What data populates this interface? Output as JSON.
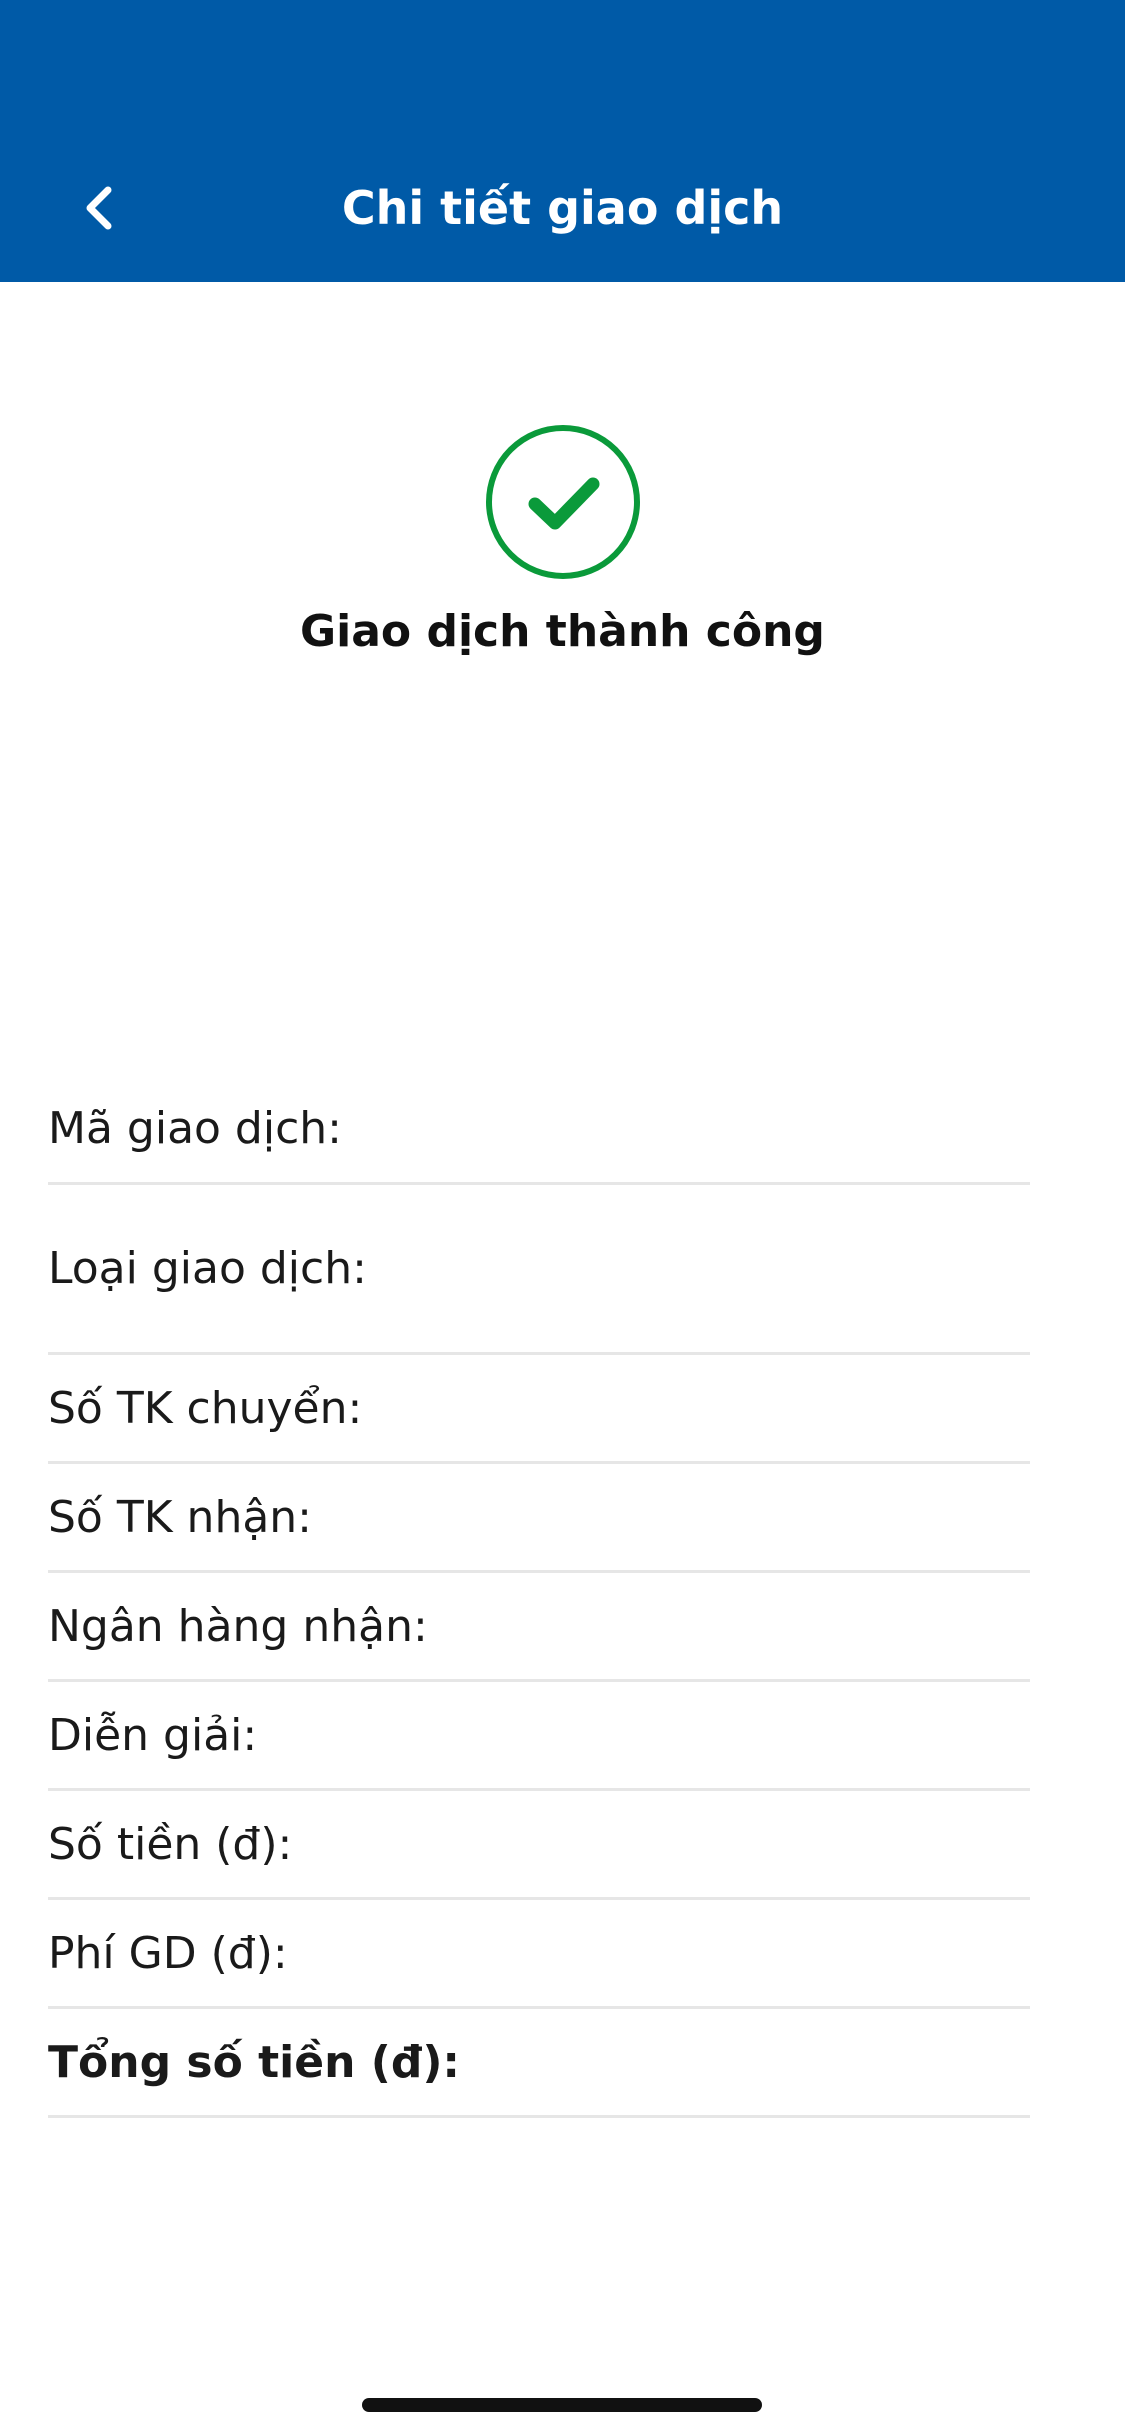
{
  "header": {
    "title": "Chi tiết giao dịch",
    "background_color": "#005AA7",
    "back_icon": "chevron-left-icon"
  },
  "status": {
    "icon": "check-circle-icon",
    "icon_color": "#0A9A3A",
    "text": "Giao dịch thành công"
  },
  "details": {
    "rows": [
      {
        "label": "Mã giao dịch:",
        "value": ""
      },
      {
        "label": "Loại giao dịch:",
        "value": ""
      },
      {
        "label": "Số TK chuyển:",
        "value": ""
      },
      {
        "label": "Số TK nhận:",
        "value": ""
      },
      {
        "label": "Ngân hàng nhận:",
        "value": ""
      },
      {
        "label": "Diễn giải:",
        "value": ""
      },
      {
        "label": "Số tiền (đ):",
        "value": ""
      },
      {
        "label": "Phí GD (đ):",
        "value": ""
      },
      {
        "label": "Tổng số tiền (đ):",
        "value": ""
      }
    ]
  }
}
